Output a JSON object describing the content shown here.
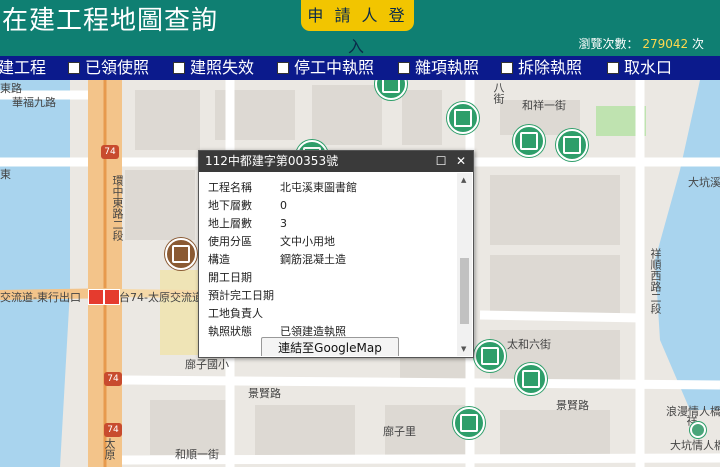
{
  "header": {
    "title": "在建工程地圖查詢",
    "login_label": "申 請 人 登 入",
    "views_label": "瀏覽次數：",
    "views_count": "279042",
    "views_unit": "次"
  },
  "nav": {
    "items": [
      "建工程",
      "已領使照",
      "建照失效",
      "停工中執照",
      "雜項執照",
      "拆除執照",
      "取水口"
    ]
  },
  "map": {
    "labels": {
      "l1": "華福九路",
      "l2": "和祥一街",
      "l3": "八街",
      "l4": "大坑溪",
      "l5": "環中東路二段",
      "l6": "祥順西路二段",
      "l7": "交流道-東行出口",
      "l8": "台74-太原交流道",
      "l9": "太和六街",
      "l10": "景賢路",
      "l11": "景賢路",
      "l12": "廍子國小",
      "l13": "廍子里",
      "l14": "和順一街",
      "l15": "太原",
      "l16": "浪漫情人橋",
      "l17": "大坑情人橋",
      "l18": "74",
      "l19": "74",
      "l20": "74",
      "l21": "祥",
      "l22": "路",
      "l23": "東路",
      "l24": "東"
    }
  },
  "popup": {
    "title": "112中都建字第00353號",
    "rows": [
      {
        "k": "工程名稱",
        "v": "北屯溪東圖書館"
      },
      {
        "k": "地下層數",
        "v": "0"
      },
      {
        "k": "地上層數",
        "v": "3"
      },
      {
        "k": "使用分區",
        "v": "文中小用地"
      },
      {
        "k": "構造",
        "v": "鋼筋混凝土造"
      },
      {
        "k": "開工日期",
        "v": ""
      },
      {
        "k": "預計完工日期",
        "v": ""
      },
      {
        "k": "工地負責人",
        "v": ""
      },
      {
        "k": "執照狀態",
        "v": "已領建造執照"
      }
    ],
    "gmap_label": "連結至GoogleMap"
  },
  "colors": {
    "header_bg": "#0f7f72",
    "nav_bg": "#0b1a8c",
    "login_bg": "#f2c500",
    "pin_green": "#2e9e6a",
    "water": "#a9d4ee"
  }
}
